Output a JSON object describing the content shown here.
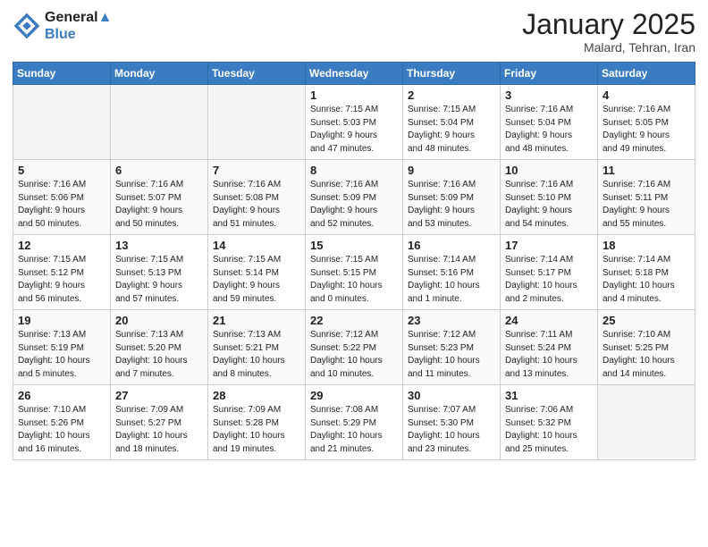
{
  "header": {
    "logo_line1": "General",
    "logo_line2": "Blue",
    "month": "January 2025",
    "location": "Malard, Tehran, Iran"
  },
  "weekdays": [
    "Sunday",
    "Monday",
    "Tuesday",
    "Wednesday",
    "Thursday",
    "Friday",
    "Saturday"
  ],
  "weeks": [
    [
      {
        "day": "",
        "info": ""
      },
      {
        "day": "",
        "info": ""
      },
      {
        "day": "",
        "info": ""
      },
      {
        "day": "1",
        "info": "Sunrise: 7:15 AM\nSunset: 5:03 PM\nDaylight: 9 hours\nand 47 minutes."
      },
      {
        "day": "2",
        "info": "Sunrise: 7:15 AM\nSunset: 5:04 PM\nDaylight: 9 hours\nand 48 minutes."
      },
      {
        "day": "3",
        "info": "Sunrise: 7:16 AM\nSunset: 5:04 PM\nDaylight: 9 hours\nand 48 minutes."
      },
      {
        "day": "4",
        "info": "Sunrise: 7:16 AM\nSunset: 5:05 PM\nDaylight: 9 hours\nand 49 minutes."
      }
    ],
    [
      {
        "day": "5",
        "info": "Sunrise: 7:16 AM\nSunset: 5:06 PM\nDaylight: 9 hours\nand 50 minutes."
      },
      {
        "day": "6",
        "info": "Sunrise: 7:16 AM\nSunset: 5:07 PM\nDaylight: 9 hours\nand 50 minutes."
      },
      {
        "day": "7",
        "info": "Sunrise: 7:16 AM\nSunset: 5:08 PM\nDaylight: 9 hours\nand 51 minutes."
      },
      {
        "day": "8",
        "info": "Sunrise: 7:16 AM\nSunset: 5:09 PM\nDaylight: 9 hours\nand 52 minutes."
      },
      {
        "day": "9",
        "info": "Sunrise: 7:16 AM\nSunset: 5:09 PM\nDaylight: 9 hours\nand 53 minutes."
      },
      {
        "day": "10",
        "info": "Sunrise: 7:16 AM\nSunset: 5:10 PM\nDaylight: 9 hours\nand 54 minutes."
      },
      {
        "day": "11",
        "info": "Sunrise: 7:16 AM\nSunset: 5:11 PM\nDaylight: 9 hours\nand 55 minutes."
      }
    ],
    [
      {
        "day": "12",
        "info": "Sunrise: 7:15 AM\nSunset: 5:12 PM\nDaylight: 9 hours\nand 56 minutes."
      },
      {
        "day": "13",
        "info": "Sunrise: 7:15 AM\nSunset: 5:13 PM\nDaylight: 9 hours\nand 57 minutes."
      },
      {
        "day": "14",
        "info": "Sunrise: 7:15 AM\nSunset: 5:14 PM\nDaylight: 9 hours\nand 59 minutes."
      },
      {
        "day": "15",
        "info": "Sunrise: 7:15 AM\nSunset: 5:15 PM\nDaylight: 10 hours\nand 0 minutes."
      },
      {
        "day": "16",
        "info": "Sunrise: 7:14 AM\nSunset: 5:16 PM\nDaylight: 10 hours\nand 1 minute."
      },
      {
        "day": "17",
        "info": "Sunrise: 7:14 AM\nSunset: 5:17 PM\nDaylight: 10 hours\nand 2 minutes."
      },
      {
        "day": "18",
        "info": "Sunrise: 7:14 AM\nSunset: 5:18 PM\nDaylight: 10 hours\nand 4 minutes."
      }
    ],
    [
      {
        "day": "19",
        "info": "Sunrise: 7:13 AM\nSunset: 5:19 PM\nDaylight: 10 hours\nand 5 minutes."
      },
      {
        "day": "20",
        "info": "Sunrise: 7:13 AM\nSunset: 5:20 PM\nDaylight: 10 hours\nand 7 minutes."
      },
      {
        "day": "21",
        "info": "Sunrise: 7:13 AM\nSunset: 5:21 PM\nDaylight: 10 hours\nand 8 minutes."
      },
      {
        "day": "22",
        "info": "Sunrise: 7:12 AM\nSunset: 5:22 PM\nDaylight: 10 hours\nand 10 minutes."
      },
      {
        "day": "23",
        "info": "Sunrise: 7:12 AM\nSunset: 5:23 PM\nDaylight: 10 hours\nand 11 minutes."
      },
      {
        "day": "24",
        "info": "Sunrise: 7:11 AM\nSunset: 5:24 PM\nDaylight: 10 hours\nand 13 minutes."
      },
      {
        "day": "25",
        "info": "Sunrise: 7:10 AM\nSunset: 5:25 PM\nDaylight: 10 hours\nand 14 minutes."
      }
    ],
    [
      {
        "day": "26",
        "info": "Sunrise: 7:10 AM\nSunset: 5:26 PM\nDaylight: 10 hours\nand 16 minutes."
      },
      {
        "day": "27",
        "info": "Sunrise: 7:09 AM\nSunset: 5:27 PM\nDaylight: 10 hours\nand 18 minutes."
      },
      {
        "day": "28",
        "info": "Sunrise: 7:09 AM\nSunset: 5:28 PM\nDaylight: 10 hours\nand 19 minutes."
      },
      {
        "day": "29",
        "info": "Sunrise: 7:08 AM\nSunset: 5:29 PM\nDaylight: 10 hours\nand 21 minutes."
      },
      {
        "day": "30",
        "info": "Sunrise: 7:07 AM\nSunset: 5:30 PM\nDaylight: 10 hours\nand 23 minutes."
      },
      {
        "day": "31",
        "info": "Sunrise: 7:06 AM\nSunset: 5:32 PM\nDaylight: 10 hours\nand 25 minutes."
      },
      {
        "day": "",
        "info": ""
      }
    ]
  ]
}
